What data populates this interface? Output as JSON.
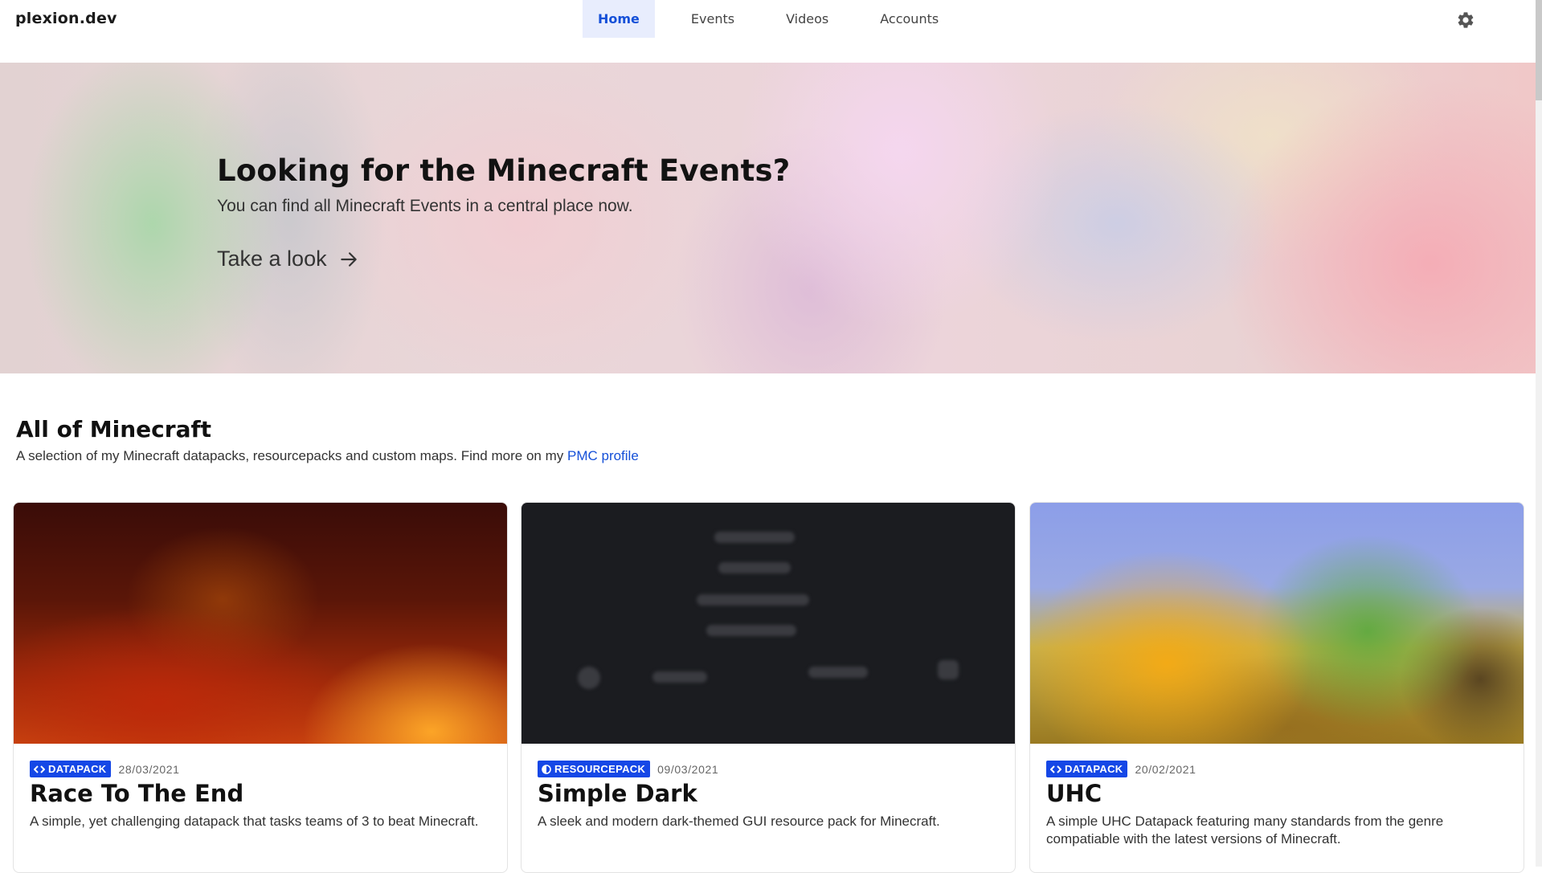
{
  "brand": "plexion.dev",
  "nav": {
    "items": [
      {
        "label": "Home",
        "active": true
      },
      {
        "label": "Events",
        "active": false
      },
      {
        "label": "Videos",
        "active": false
      },
      {
        "label": "Accounts",
        "active": false
      }
    ],
    "settings_icon": "gear-icon"
  },
  "hero": {
    "title": "Looking for the Minecraft Events?",
    "subtitle": "You can find all Minecraft Events in a central place now.",
    "cta_label": "Take a look",
    "cta_icon": "arrow-right-icon"
  },
  "section": {
    "title": "All of Minecraft",
    "description": "A selection of my Minecraft datapacks, resourcepacks and custom maps. Find more on my",
    "link_label": "PMC profile"
  },
  "cards": [
    {
      "badge": "DATAPACK",
      "badge_icon": "code-icon",
      "date": "28/03/2021",
      "title": "Race To The End",
      "description": "A simple, yet challenging datapack that tasks teams of 3 to beat Minecraft."
    },
    {
      "badge": "RESOURCEPACK",
      "badge_icon": "contrast-icon",
      "date": "09/03/2021",
      "title": "Simple Dark",
      "description": "A sleek and modern dark-themed GUI resource pack for Minecraft."
    },
    {
      "badge": "DATAPACK",
      "badge_icon": "code-icon",
      "date": "20/02/2021",
      "title": "UHC",
      "description": "A simple UHC Datapack featuring many standards from the genre compatiable with the latest versions of Minecraft."
    }
  ],
  "colors": {
    "accent": "#1550d8",
    "badge": "#1547e6",
    "nav_active_bg": "#e8edfd"
  }
}
